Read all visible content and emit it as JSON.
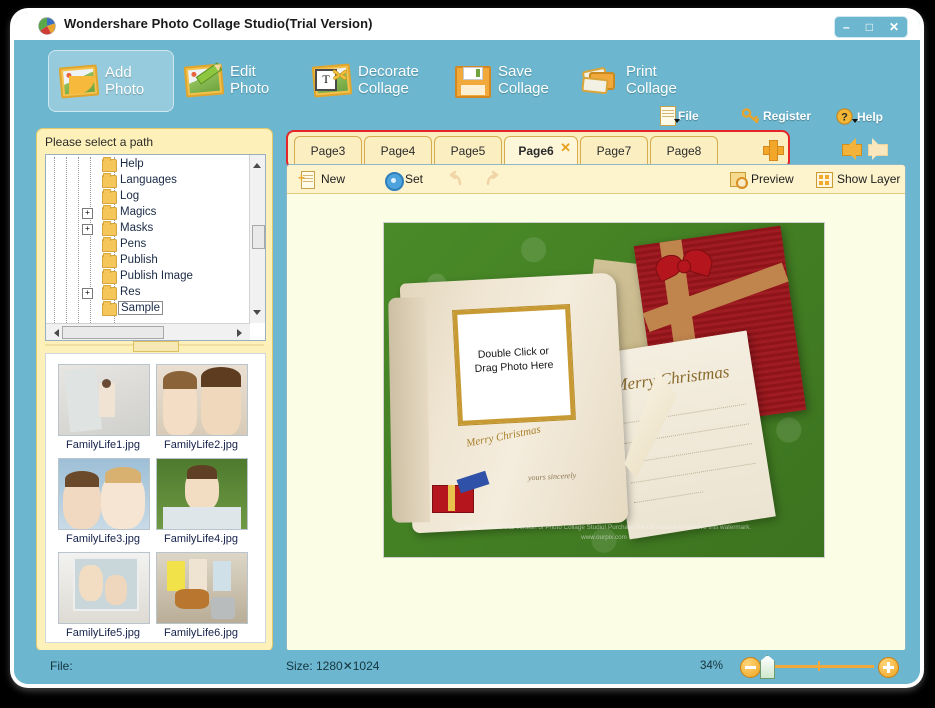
{
  "window": {
    "title": "Wondershare Photo Collage Studio(Trial Version)",
    "logo_icon": "app-logo-icon",
    "minimize_label": "–",
    "maximize_label": "□",
    "close_label": "✕"
  },
  "toolbar": {
    "buttons": [
      {
        "label_line1": "Add",
        "label_line2": "Photo",
        "icon": "add-photo-icon",
        "active": true
      },
      {
        "label_line1": "Edit",
        "label_line2": "Photo",
        "icon": "edit-photo-icon",
        "active": false
      },
      {
        "label_line1": "Decorate",
        "label_line2": "Collage",
        "icon": "decorate-collage-icon",
        "active": false
      },
      {
        "label_line1": "Save",
        "label_line2": "Collage",
        "icon": "save-collage-icon",
        "active": false
      },
      {
        "label_line1": "Print",
        "label_line2": "Collage",
        "icon": "print-collage-icon",
        "active": false
      }
    ],
    "mini_buttons": [
      {
        "label": "File",
        "icon": "file-icon",
        "has_caret": true
      },
      {
        "label": "Register",
        "icon": "key-icon",
        "has_caret": false
      },
      {
        "label": "Help",
        "icon": "question-icon",
        "has_caret": true
      }
    ]
  },
  "left_panel": {
    "path_label": "Please select a path",
    "tree_items": [
      {
        "label": "Help",
        "expandable": false,
        "selected": false
      },
      {
        "label": "Languages",
        "expandable": false,
        "selected": false
      },
      {
        "label": "Log",
        "expandable": false,
        "selected": false
      },
      {
        "label": "Magics",
        "expandable": true,
        "selected": false
      },
      {
        "label": "Masks",
        "expandable": true,
        "selected": false
      },
      {
        "label": "Pens",
        "expandable": false,
        "selected": false
      },
      {
        "label": "Publish",
        "expandable": false,
        "selected": false
      },
      {
        "label": "Publish Image",
        "expandable": false,
        "selected": false
      },
      {
        "label": "Res",
        "expandable": true,
        "selected": false
      },
      {
        "label": "Sample",
        "expandable": false,
        "selected": true
      }
    ],
    "expand_glyph": "+",
    "thumbnails": [
      {
        "name": "FamilyLife1.jpg"
      },
      {
        "name": "FamilyLife2.jpg"
      },
      {
        "name": "FamilyLife3.jpg"
      },
      {
        "name": "FamilyLife4.jpg"
      },
      {
        "name": "FamilyLife5.jpg"
      },
      {
        "name": "FamilyLife6.jpg"
      }
    ]
  },
  "tabs": {
    "items": [
      {
        "label": "Page3",
        "active": false,
        "closable": false
      },
      {
        "label": "Page4",
        "active": false,
        "closable": false
      },
      {
        "label": "Page5",
        "active": false,
        "closable": false
      },
      {
        "label": "Page6",
        "active": true,
        "closable": true
      },
      {
        "label": "Page7",
        "active": false,
        "closable": false
      },
      {
        "label": "Page8",
        "active": false,
        "closable": false
      }
    ],
    "close_glyph": "✕",
    "add_tab_icon": "add-page-icon",
    "prev_arrow_icon": "prev-page-arrow-icon",
    "next_arrow_icon": "next-page-arrow-icon"
  },
  "subbar": {
    "new_label": "New",
    "set_label": "Set",
    "undo_icon": "undo-icon",
    "redo_icon": "redo-icon",
    "preview_label": "Preview",
    "show_layer_label": "Show Layer"
  },
  "canvas": {
    "placeholder_line1": "Double Click or",
    "placeholder_line2": "Drag Photo Here",
    "book_text": "Merry Christmas",
    "book_signature": "yours sincerely",
    "card_text": "Merry Christmas",
    "watermark_line1": "Created with the trial version of Photo Collage Studio!  Purchase the full version to remove this watermark.",
    "watermark_line2": "www.ourpix.com"
  },
  "statusbar": {
    "file_label": "File:",
    "size_label": "Size:  1280✕1024",
    "zoom_percent": "34%",
    "zoom_out_icon": "zoom-out-icon",
    "zoom_in_icon": "zoom-in-icon"
  },
  "colors": {
    "window_blue": "#6cb7cf",
    "panel_cream": "#fdf0b8",
    "tab_highlight_red": "#e4262a",
    "accent_orange": "#f0a93a",
    "canvas_bg": "#fbfde4"
  }
}
